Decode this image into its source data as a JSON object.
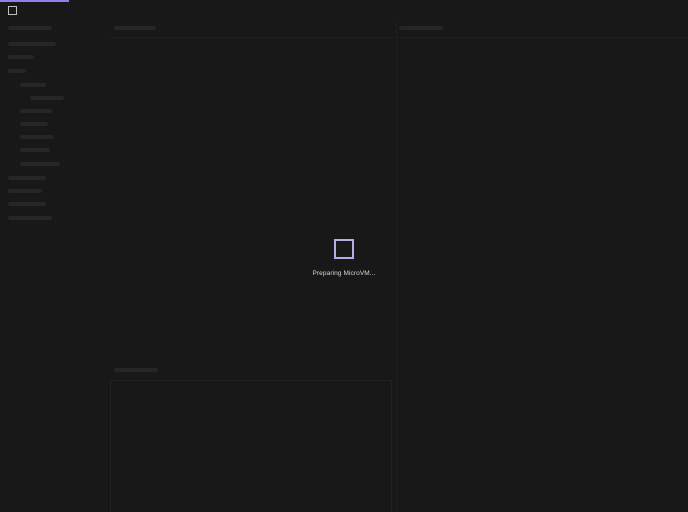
{
  "app": {
    "loading_progress": 0.1,
    "accent_color": "#8b83e6",
    "logo_icon": "square-outline-icon"
  },
  "loader": {
    "icon": "square-outline-icon",
    "icon_color": "#b5ade8",
    "status_text": "Preparing MicroVM..."
  },
  "sidebar": {
    "state": "loading",
    "items": [
      {
        "level": 0
      },
      {
        "level": 0
      },
      {
        "level": 0
      },
      {
        "level": 0
      },
      {
        "level": 1
      },
      {
        "level": 2
      },
      {
        "level": 1
      },
      {
        "level": 1
      },
      {
        "level": 1
      },
      {
        "level": 1
      },
      {
        "level": 1
      },
      {
        "level": 0
      },
      {
        "level": 0
      },
      {
        "level": 0
      },
      {
        "level": 0
      }
    ]
  },
  "panels": {
    "main": {
      "state": "loading"
    },
    "right": {
      "state": "loading"
    },
    "terminal": {
      "state": "loading"
    }
  }
}
